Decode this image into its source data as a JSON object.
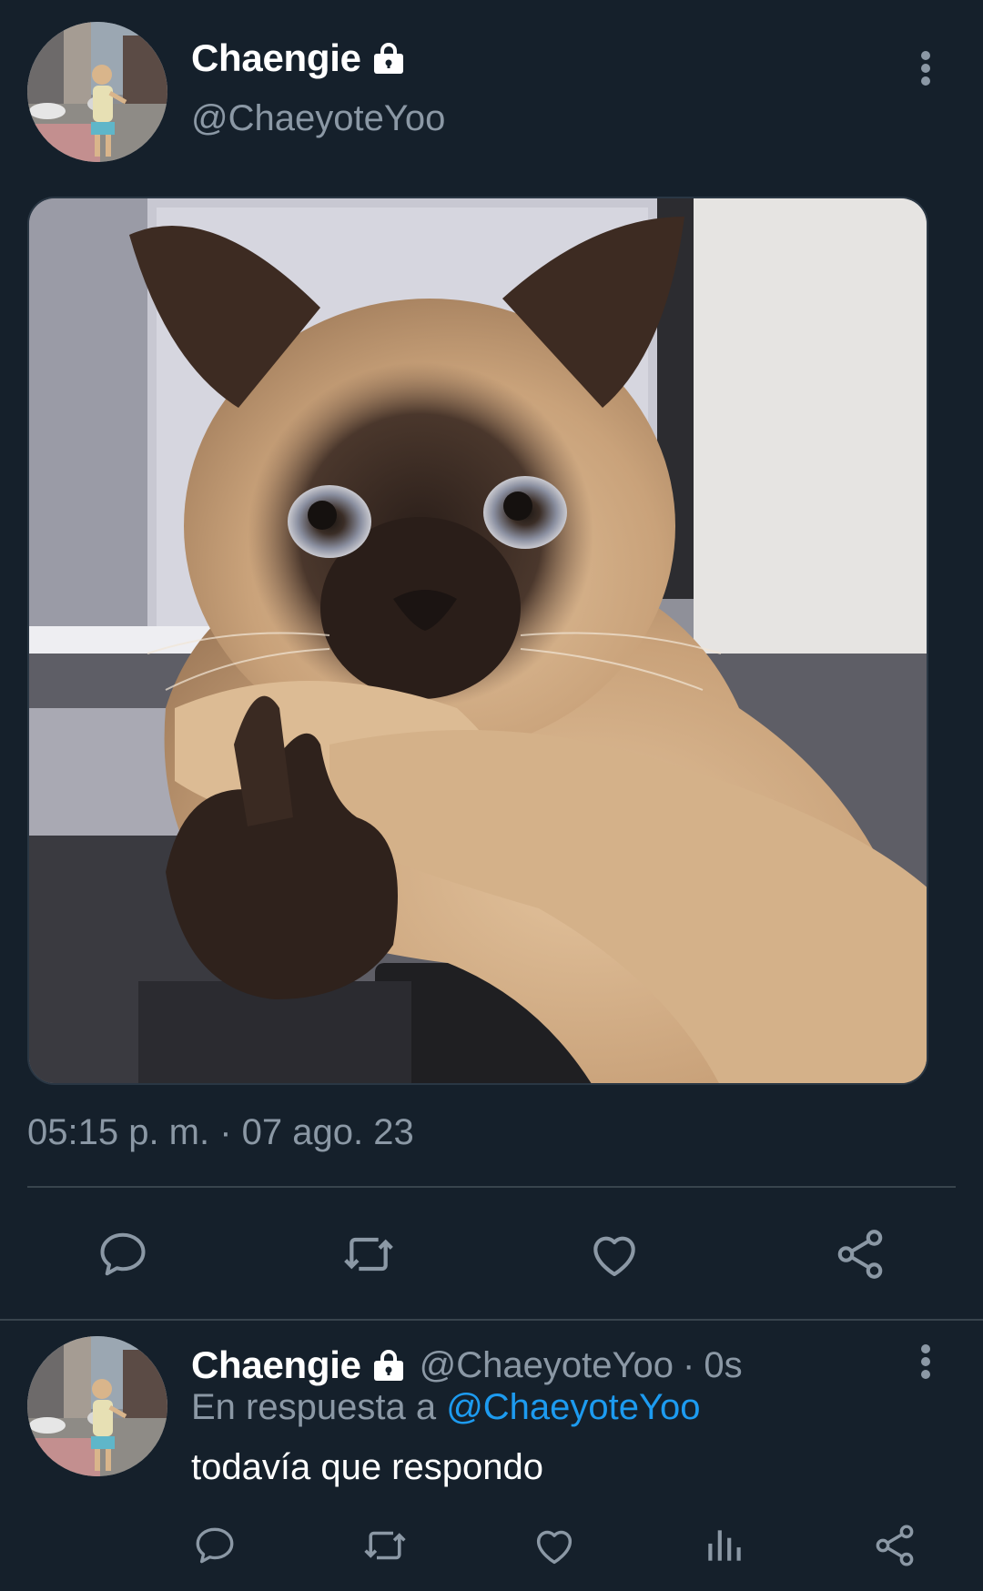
{
  "tweet": {
    "author_name": "Chaengie",
    "author_handle": "@ChaeyoteYoo",
    "protected_icon": "lock-icon",
    "media_description_icon": "image",
    "timestamp": "05:15 p. m. · 07 ago. 23",
    "actions": [
      {
        "name": "reply",
        "icon": "reply-icon"
      },
      {
        "name": "retweet",
        "icon": "retweet-icon"
      },
      {
        "name": "like",
        "icon": "heart-icon"
      },
      {
        "name": "share",
        "icon": "share-icon"
      }
    ]
  },
  "reply": {
    "author_name": "Chaengie",
    "author_handle": "@ChaeyoteYoo",
    "separator": "·",
    "time_ago": "0s",
    "in_reply_to_prefix": "En respuesta a",
    "in_reply_to_handle": "@ChaeyoteYoo",
    "text": "todavía que respondo",
    "actions": [
      {
        "name": "reply",
        "icon": "reply-icon"
      },
      {
        "name": "retweet",
        "icon": "retweet-icon"
      },
      {
        "name": "like",
        "icon": "heart-icon"
      },
      {
        "name": "analytics",
        "icon": "analytics-icon"
      },
      {
        "name": "share",
        "icon": "share-icon"
      }
    ]
  },
  "colors": {
    "background": "#15202b",
    "secondary_text": "#8b98a5",
    "mention": "#1d9bf0",
    "divider": "#38444d"
  }
}
